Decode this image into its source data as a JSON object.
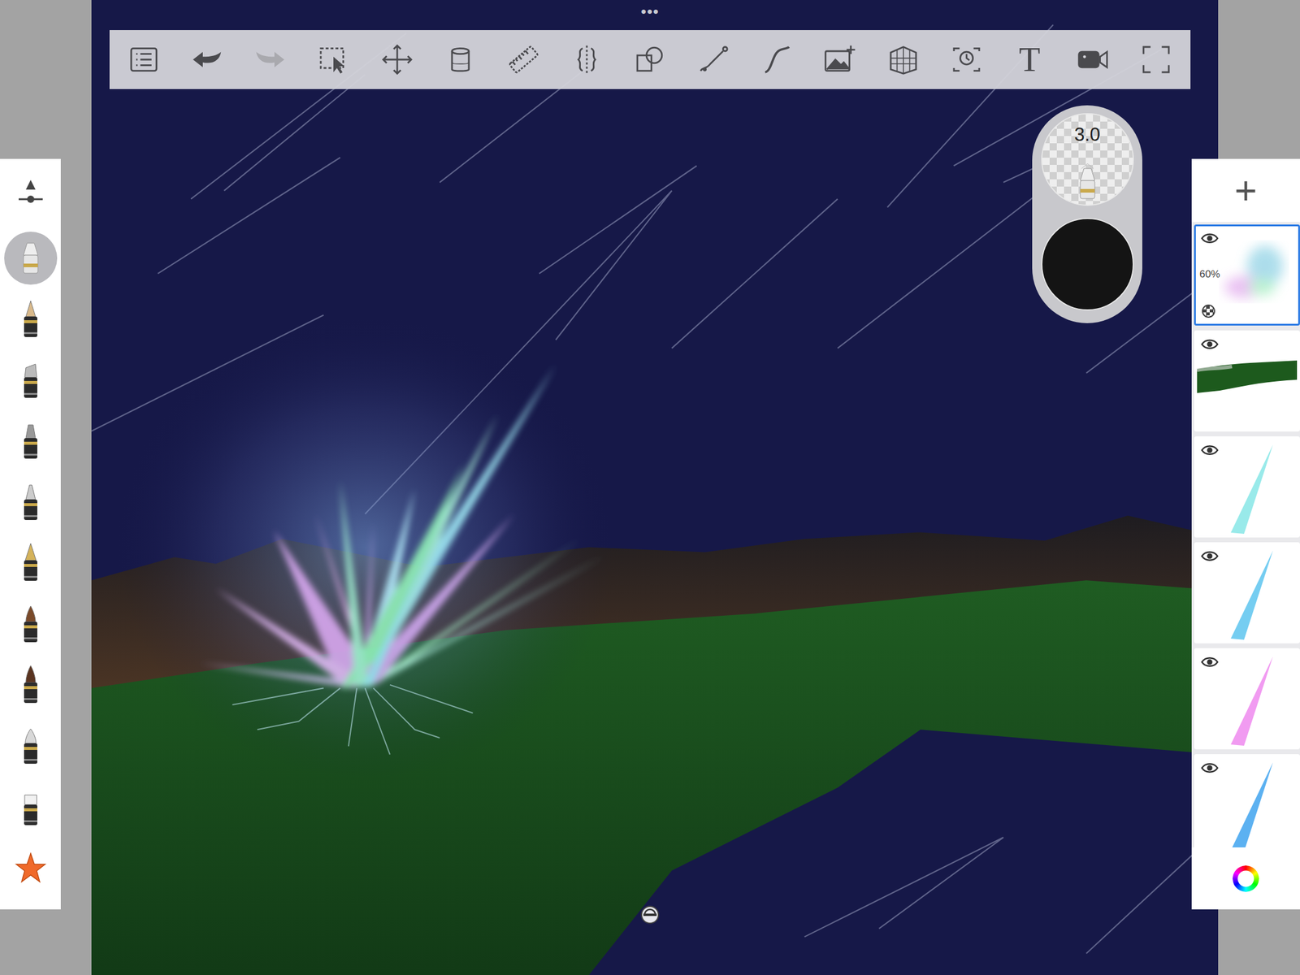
{
  "toolbar": {
    "more": "•••",
    "tools": [
      {
        "kind": "list",
        "disabled": false
      },
      {
        "kind": "undo",
        "disabled": false
      },
      {
        "kind": "redo",
        "disabled": true
      },
      {
        "kind": "select",
        "disabled": false
      },
      {
        "kind": "move",
        "disabled": false
      },
      {
        "kind": "bucket",
        "disabled": false
      },
      {
        "kind": "ruler",
        "disabled": false
      },
      {
        "kind": "symmetry",
        "disabled": false
      },
      {
        "kind": "shapes",
        "disabled": false
      },
      {
        "kind": "polyline",
        "disabled": false
      },
      {
        "kind": "stroke",
        "disabled": false
      },
      {
        "kind": "image",
        "disabled": false
      },
      {
        "kind": "perspective",
        "disabled": false
      },
      {
        "kind": "timelapse",
        "disabled": false
      },
      {
        "kind": "text",
        "label": "T",
        "disabled": false
      },
      {
        "kind": "video",
        "disabled": false
      },
      {
        "kind": "fullscreen",
        "disabled": false
      }
    ]
  },
  "brush_puck": {
    "size": "3.0",
    "color": "#141414"
  },
  "brushes": [
    {
      "kind": "slider",
      "selected": false
    },
    {
      "kind": "airbrush",
      "selected": true
    },
    {
      "kind": "pencil",
      "selected": false
    },
    {
      "kind": "marker",
      "selected": false
    },
    {
      "kind": "inkpen",
      "selected": false
    },
    {
      "kind": "technical",
      "selected": false
    },
    {
      "kind": "fountain",
      "selected": false
    },
    {
      "kind": "paintbrush",
      "selected": false
    },
    {
      "kind": "brush",
      "selected": false
    },
    {
      "kind": "soft",
      "selected": false
    },
    {
      "kind": "eraser",
      "selected": false
    },
    {
      "kind": "star",
      "selected": false
    }
  ],
  "layers": {
    "add": "+",
    "items": [
      {
        "kind": "blur",
        "opacity": "60%",
        "visible": true,
        "selected": true,
        "color": "#9fd8e8"
      },
      {
        "kind": "grass",
        "visible": true,
        "selected": false,
        "color": "#1d5a1d"
      },
      {
        "kind": "spike",
        "visible": true,
        "selected": false,
        "color": "#8ee8e8"
      },
      {
        "kind": "spike",
        "visible": true,
        "selected": false,
        "color": "#66c8f0"
      },
      {
        "kind": "spike",
        "visible": true,
        "selected": false,
        "color": "#f090f0"
      },
      {
        "kind": "spike",
        "visible": true,
        "selected": false,
        "color": "#4aa8f0"
      }
    ]
  }
}
